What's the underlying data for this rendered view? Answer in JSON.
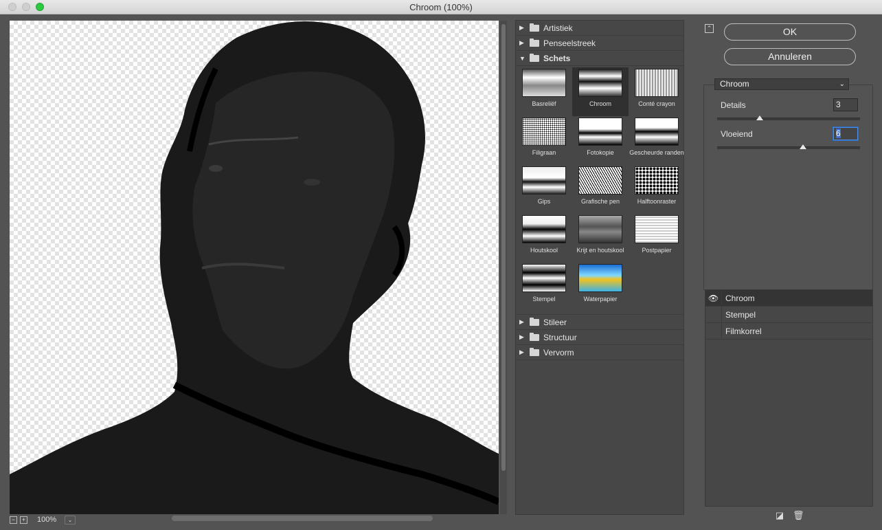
{
  "window": {
    "title": "Chroom (100%)"
  },
  "preview": {
    "zoom": "100%",
    "zoom_out": "−",
    "zoom_in": "+",
    "zoom_menu": "⌄"
  },
  "gallery": {
    "categories_top": [
      {
        "label": "Artistiek"
      },
      {
        "label": "Penseelstreek"
      }
    ],
    "open_category": {
      "label": "Schets"
    },
    "thumbnails": [
      {
        "label": "Basreliëf"
      },
      {
        "label": "Chroom",
        "selected": true
      },
      {
        "label": "Conté crayon"
      },
      {
        "label": "Filigraan"
      },
      {
        "label": "Fotokopie"
      },
      {
        "label": "Gescheurde randen"
      },
      {
        "label": "Gips"
      },
      {
        "label": "Grafische pen"
      },
      {
        "label": "Halftoonraster"
      },
      {
        "label": "Houtskool"
      },
      {
        "label": "Krijt en houtskool"
      },
      {
        "label": "Postpapier"
      },
      {
        "label": "Stempel"
      },
      {
        "label": "Waterpapier"
      }
    ],
    "categories_bottom": [
      {
        "label": "Stileer"
      },
      {
        "label": "Structuur"
      },
      {
        "label": "Vervorm"
      }
    ]
  },
  "buttons": {
    "ok": "OK",
    "cancel": "Annuleren"
  },
  "filter_select": {
    "value": "Chroom"
  },
  "params": {
    "details": {
      "label": "Details",
      "value": "3",
      "slider_fraction": 0.3
    },
    "smooth": {
      "label": "Vloeiend",
      "value": "6",
      "slider_fraction": 0.6
    }
  },
  "layers": [
    {
      "name": "Chroom",
      "visible": true,
      "active": true
    },
    {
      "name": "Stempel",
      "visible": false,
      "active": false
    },
    {
      "name": "Filmkorrel",
      "visible": false,
      "active": false
    }
  ],
  "icons": {
    "eye": "eye-icon",
    "new_layer": "new-effect-layer-icon",
    "delete": "trash-icon",
    "collapse": "collapse-up-icon",
    "folder": "folder-icon"
  }
}
